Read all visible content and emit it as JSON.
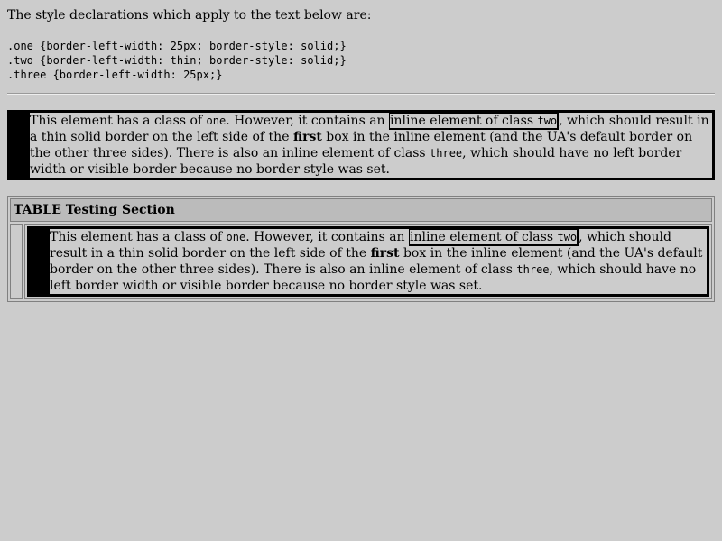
{
  "intro": "The style declarations which apply to the text below are:",
  "styles": ".one {border-left-width: 25px; border-style: solid;}\n.two {border-left-width: thin; border-style: solid;}\n.three {border-left-width: 25px;}",
  "para": {
    "t1": "This element has a class of ",
    "c1": "one",
    "t2": ". However, it contains an ",
    "span_two_text": "inline element of class ",
    "c2": "two",
    "t3": ", which should result in a thin solid border on the left side of the ",
    "strong": "first",
    "t4": " box in the inline element (and the UA's default border on the other three sides). There is also an inline element of class ",
    "c3": "three",
    "t5": ", which should have no left border width or visible border because no border style was set."
  },
  "table": {
    "header": "TABLE Testing Section"
  }
}
